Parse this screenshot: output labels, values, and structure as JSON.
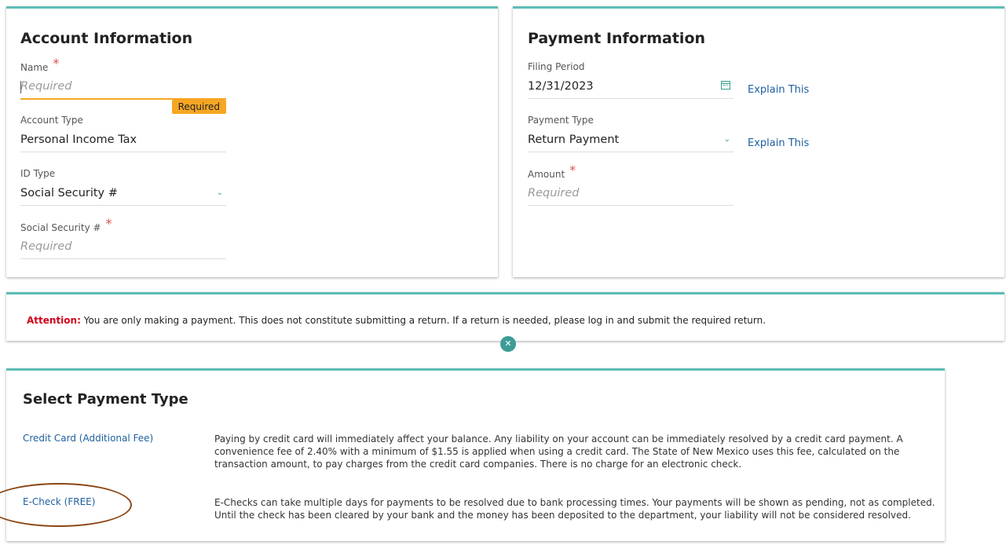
{
  "account": {
    "title": "Account Information",
    "name": {
      "label": "Name",
      "placeholder": "Required",
      "error": "Required"
    },
    "account_type": {
      "label": "Account Type",
      "value": "Personal Income Tax"
    },
    "id_type": {
      "label": "ID Type",
      "value": "Social Security #"
    },
    "ssn": {
      "label": "Social Security #",
      "placeholder": "Required"
    }
  },
  "payment": {
    "title": "Payment Information",
    "filing_period": {
      "label": "Filing Period",
      "value": "12/31/2023",
      "explain": "Explain This"
    },
    "payment_type": {
      "label": "Payment Type",
      "value": "Return Payment",
      "explain": "Explain This"
    },
    "amount": {
      "label": "Amount",
      "placeholder": "Required"
    }
  },
  "attention": {
    "label": "Attention:",
    "text": " You are only making a payment. This does not constitute submitting a return. If a return is needed, please log in and submit the required return."
  },
  "select_payment": {
    "title": "Select Payment Type",
    "options": [
      {
        "label": "Credit Card (Additional Fee)",
        "description": "Paying by credit card will immediately affect your balance. Any liability on your account can be immediately resolved by a credit card payment. A convenience fee of 2.40% with a minimum of $1.55 is applied when using a credit card. The State of New Mexico uses this fee, calculated on the transaction amount, to pay charges from the credit card companies. There is no charge for an electronic check."
      },
      {
        "label": "E-Check (FREE)",
        "description": "E-Checks can take multiple days for payments to be resolved due to bank processing times. Your payments will be shown as pending, not as completed. Until the check has been cleared by your bank and the money has been deposited to the department, your liability will not be considered resolved."
      }
    ]
  },
  "colors": {
    "accent": "#5bbdb6",
    "link": "#1d5f9e",
    "error": "#f5a623",
    "attention": "#d0021b",
    "annotation": "#8b4513"
  }
}
